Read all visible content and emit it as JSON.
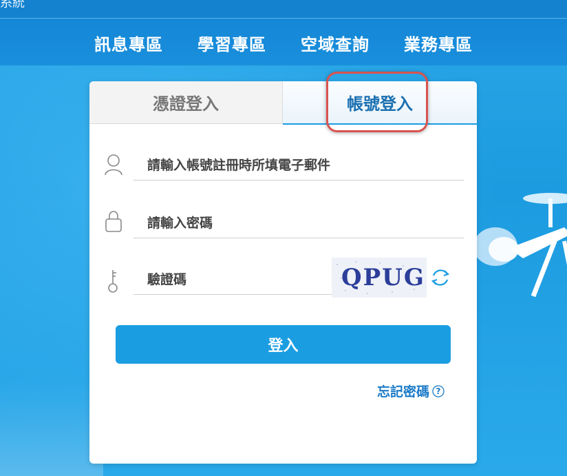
{
  "header": {
    "system_title_fragment": "糸統"
  },
  "nav": {
    "items": [
      {
        "label": "訊息專區"
      },
      {
        "label": "學習專區"
      },
      {
        "label": "空域查詢"
      },
      {
        "label": "業務專區"
      }
    ]
  },
  "login": {
    "tabs": [
      {
        "label": "憑證登入",
        "active": false
      },
      {
        "label": "帳號登入",
        "active": true
      }
    ],
    "account_placeholder": "請輸入帳號註冊時所填電子郵件",
    "password_placeholder": "請輸入密碼",
    "captcha_placeholder": "驗證碼",
    "captcha_text": "QPUG",
    "submit_label": "登入",
    "forgot_label": "忘記密碼",
    "icons": {
      "account": "user-icon",
      "password": "lock-icon",
      "captcha": "key-icon",
      "refresh": "refresh-icon",
      "help": "question-circle-icon"
    }
  },
  "colors": {
    "primary": "#1b9de2",
    "nav_bg": "#1487d6",
    "highlight": "#d9534f",
    "link": "#1a7ac7"
  }
}
